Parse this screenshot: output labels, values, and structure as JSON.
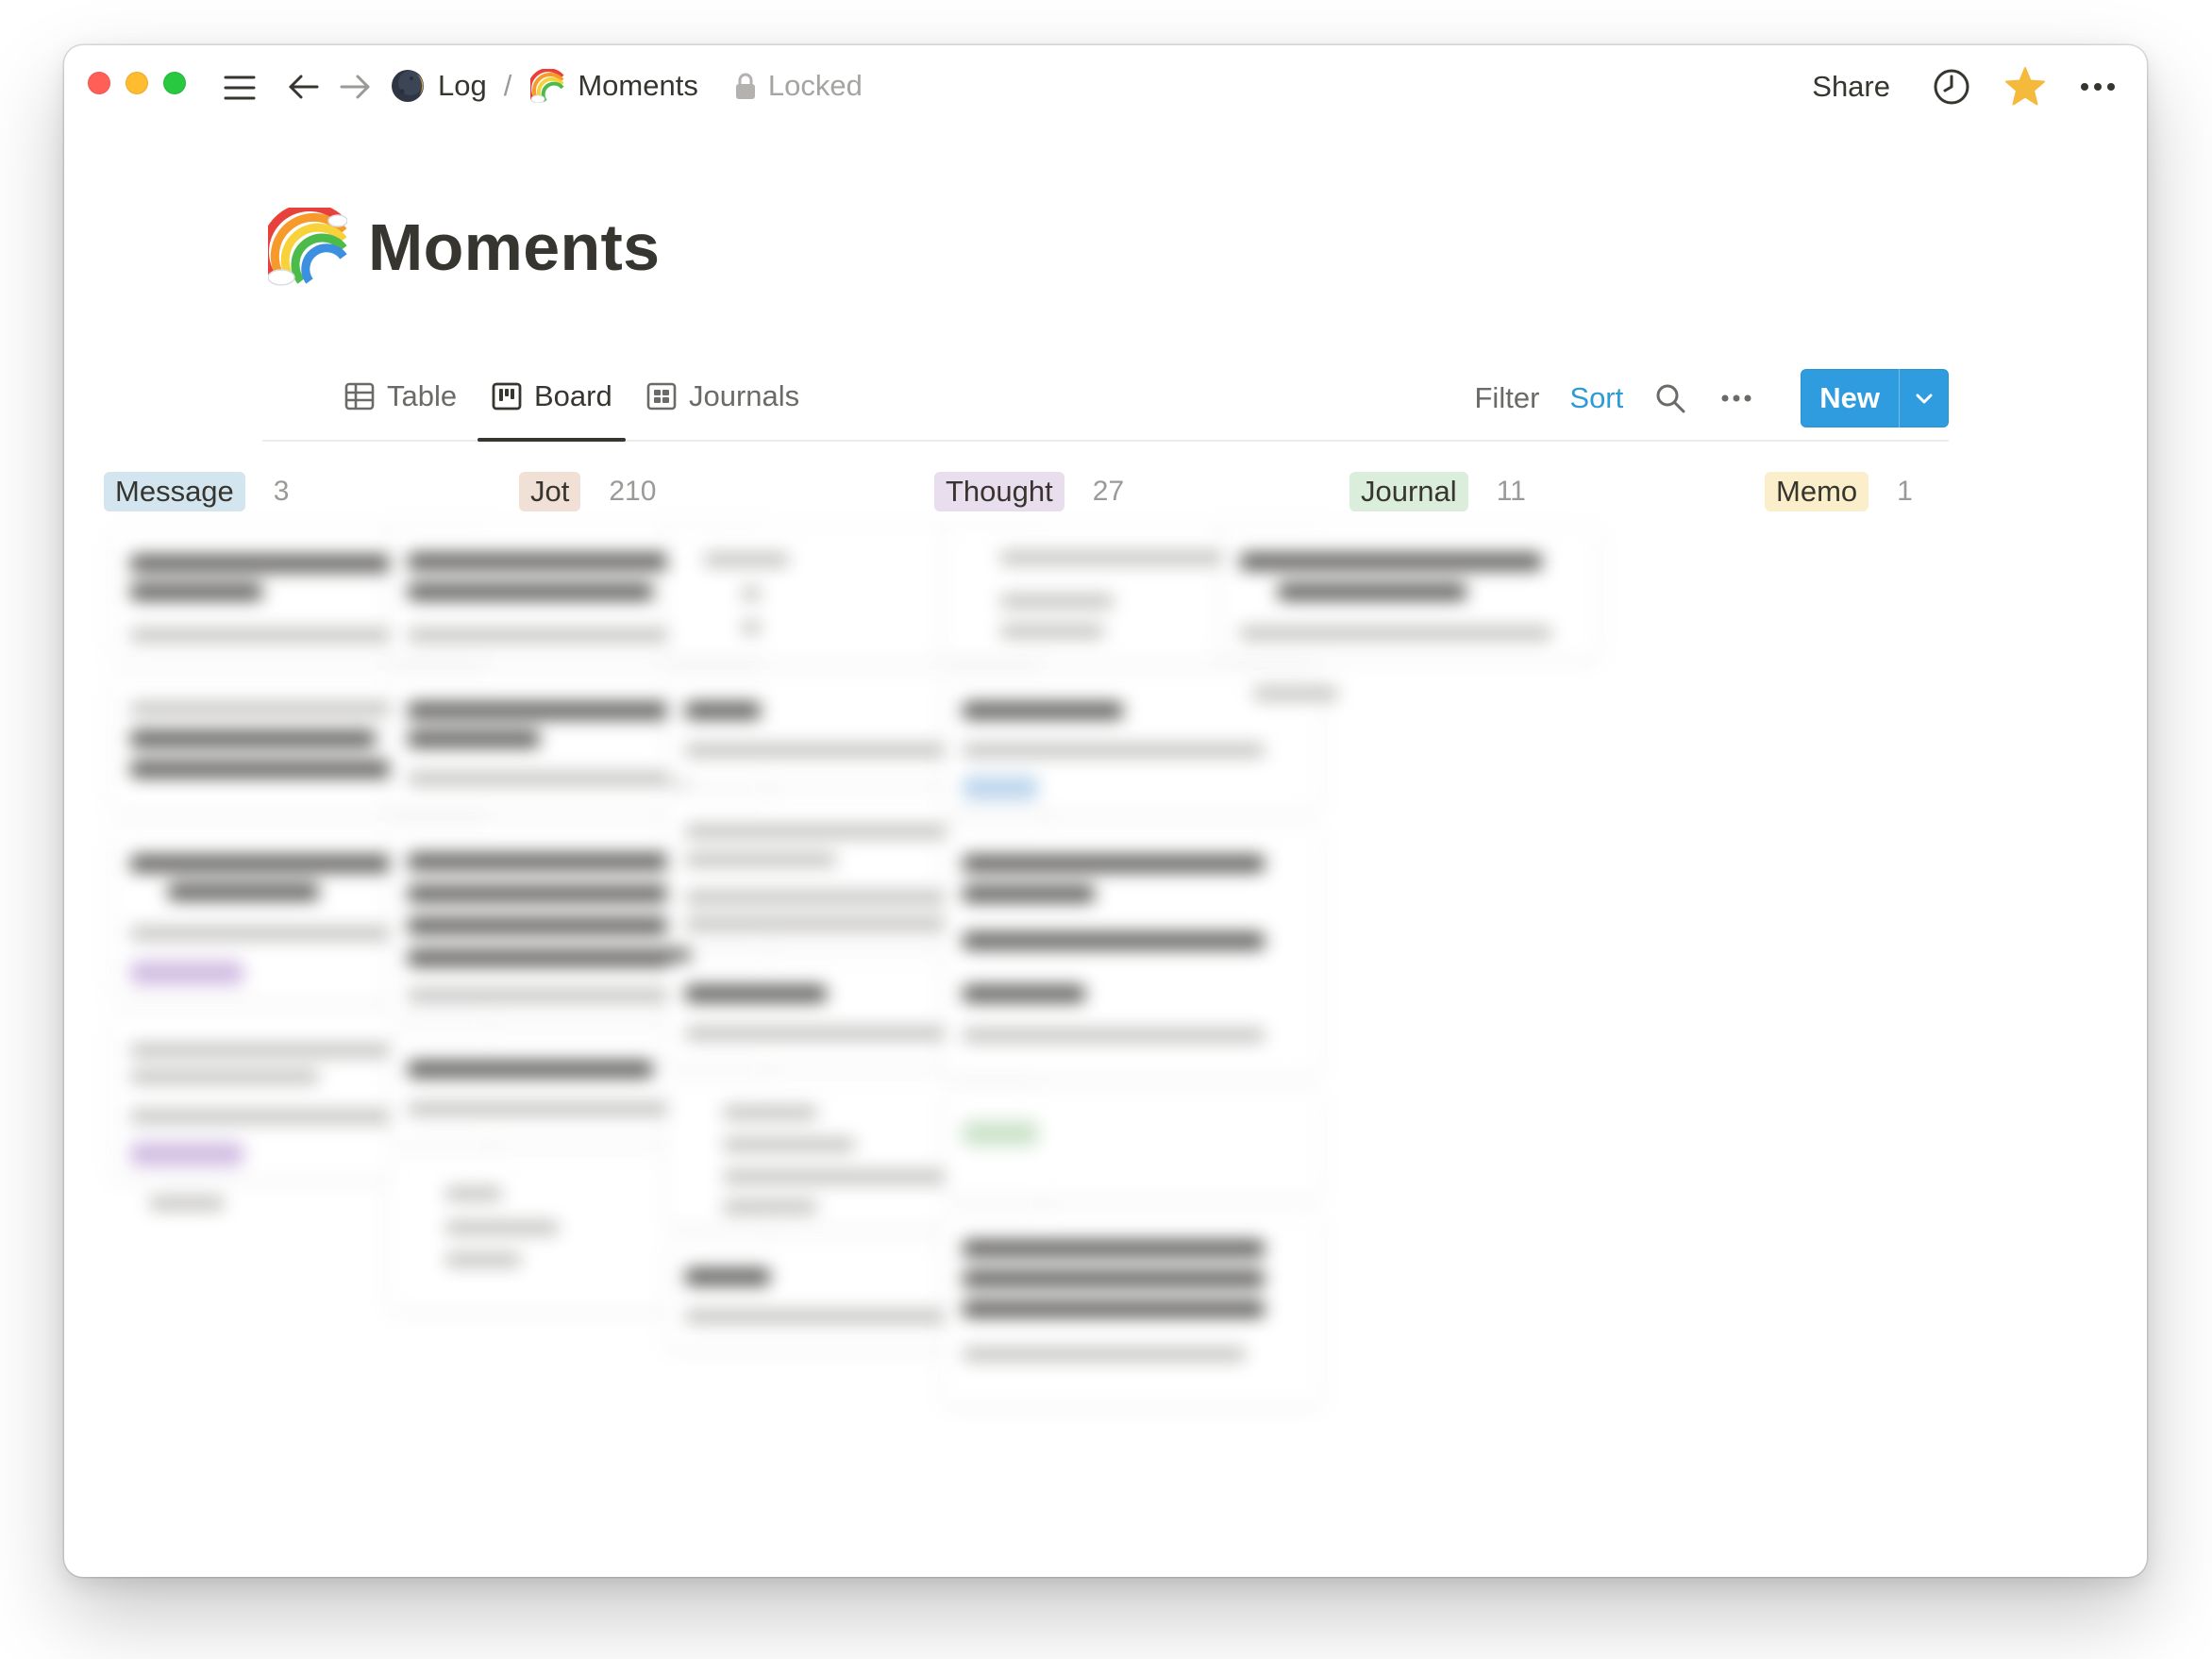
{
  "window": {
    "breadcrumbs": [
      {
        "label": "Log",
        "icon": "new-moon-icon"
      },
      {
        "label": "Moments",
        "icon": "rainbow-icon"
      }
    ],
    "breadcrumb_separator": "/",
    "lock_label": "Locked",
    "share_label": "Share"
  },
  "page": {
    "title": "Moments",
    "icon": "rainbow-icon"
  },
  "views": {
    "tabs": [
      {
        "label": "Table",
        "icon": "table-icon",
        "active": false
      },
      {
        "label": "Board",
        "icon": "board-icon",
        "active": true
      },
      {
        "label": "Journals",
        "icon": "gallery-icon",
        "active": false
      }
    ],
    "filter_label": "Filter",
    "sort_label": "Sort",
    "new_label": "New"
  },
  "board": {
    "columns": [
      {
        "label": "Message",
        "count": "3",
        "tag_bg": "#d3e5ef"
      },
      {
        "label": "Jot",
        "count": "210",
        "tag_bg": "#f1e0d6"
      },
      {
        "label": "Thought",
        "count": "27",
        "tag_bg": "#e8deee"
      },
      {
        "label": "Journal",
        "count": "11",
        "tag_bg": "#dbeddb"
      },
      {
        "label": "Memo",
        "count": "1",
        "tag_bg": "#fbeecb"
      }
    ]
  },
  "colors": {
    "accent": "#2f9ce0",
    "sort_text": "#2e9ad6",
    "star": "#f5b93b"
  }
}
